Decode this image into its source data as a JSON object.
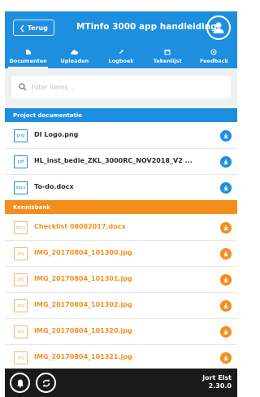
{
  "header": {
    "back_label": "Terug",
    "title": "MTinfo 3000 app handleiding"
  },
  "tabs": [
    {
      "label": "Documenten",
      "icon": "document-icon",
      "active": true
    },
    {
      "label": "Uploaden",
      "icon": "upload-cloud-icon",
      "active": false
    },
    {
      "label": "Logboek",
      "icon": "pen-icon",
      "active": false
    },
    {
      "label": "Tekenlijst",
      "icon": "calendar-icon",
      "active": false
    },
    {
      "label": "Feedback",
      "icon": "feedback-icon",
      "active": false
    }
  ],
  "filter": {
    "placeholder": "Filter items..."
  },
  "sections": {
    "project": {
      "title": "Project documentatie",
      "items": [
        {
          "type": "png",
          "name": "DI Logo.png"
        },
        {
          "type": "pdf",
          "name": "HL_inst_bedie_ZKL_3000RC_NOV2018_V2 ..."
        },
        {
          "type": "docx",
          "name": "To-do.docx"
        }
      ]
    },
    "kennisbank": {
      "title": "Kennisbank",
      "items": [
        {
          "type": "docx",
          "name": "Checklist 08082017.docx"
        },
        {
          "type": "jpg",
          "name": "IMG_20170804_101300.jpg"
        },
        {
          "type": "jpg",
          "name": "IMG_20170804_101301.jpg"
        },
        {
          "type": "jpg",
          "name": "IMG_20170804_101302.jpg"
        },
        {
          "type": "jpg",
          "name": "IMG_20170804_101320.jpg"
        },
        {
          "type": "jpg",
          "name": "IMG_20170804_101321.jpg"
        }
      ]
    }
  },
  "footer": {
    "user_name": "Jort Elst",
    "version": "2.30.0"
  },
  "colors": {
    "primary": "#1e8ede",
    "accent": "#f48d1c",
    "footer": "#1a1a1a"
  }
}
